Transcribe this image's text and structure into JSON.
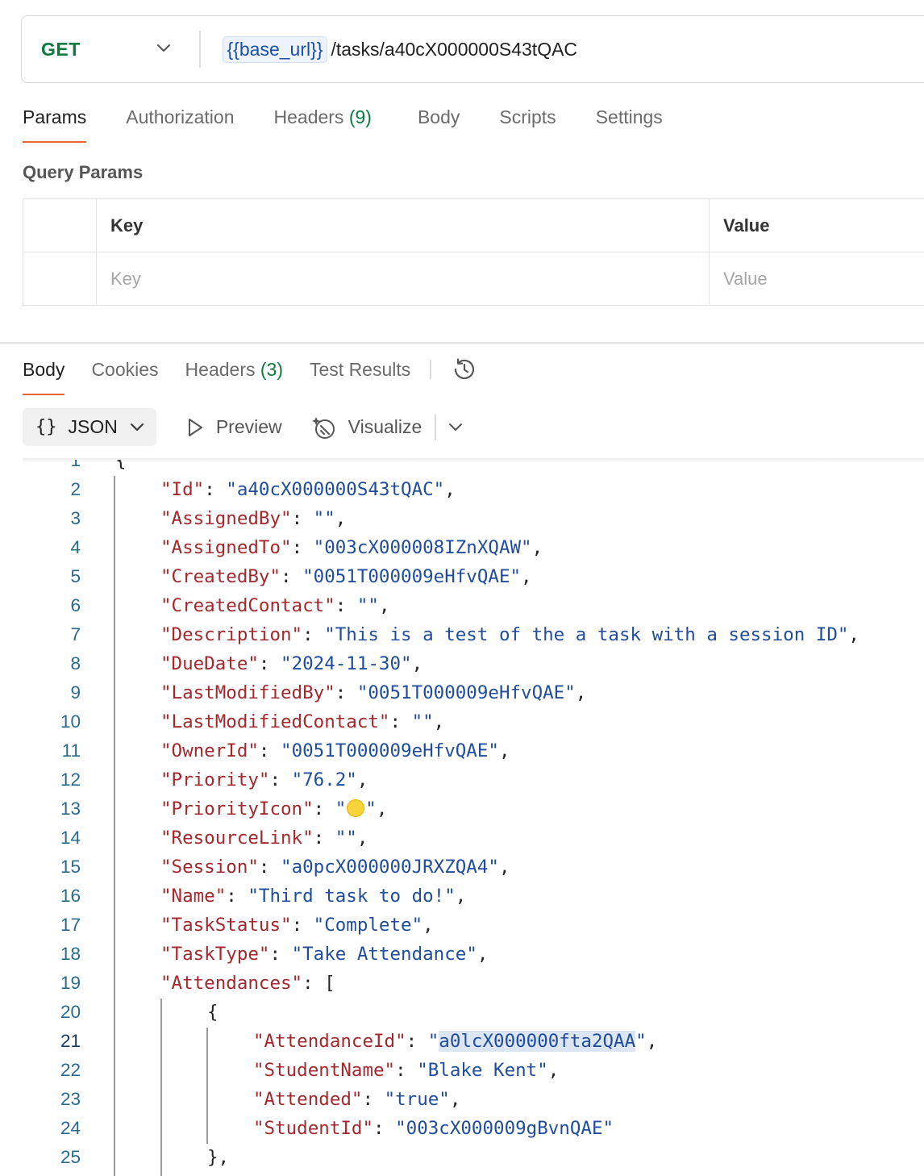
{
  "request": {
    "method": "GET",
    "url_variable": "{{base_url}}",
    "url_path": "/tasks/a40cX000000S43tQAC"
  },
  "request_tabs": [
    {
      "label": "Params",
      "count": ""
    },
    {
      "label": "Authorization",
      "count": ""
    },
    {
      "label": "Headers",
      "count": "(9)"
    },
    {
      "label": "Body",
      "count": ""
    },
    {
      "label": "Scripts",
      "count": ""
    },
    {
      "label": "Settings",
      "count": ""
    }
  ],
  "query_params": {
    "title": "Query Params",
    "col_key": "Key",
    "col_value": "Value",
    "key_placeholder": "Key",
    "value_placeholder": "Value"
  },
  "response_tabs": [
    {
      "label": "Body",
      "count": ""
    },
    {
      "label": "Cookies",
      "count": ""
    },
    {
      "label": "Headers",
      "count": "(3)"
    },
    {
      "label": "Test Results",
      "count": ""
    }
  ],
  "toolbar": {
    "format": "JSON",
    "preview": "Preview",
    "visualize": "Visualize"
  },
  "colors": {
    "method": "#0c7a3e",
    "active_tab": "#e8643a",
    "json_key": "#a3282d",
    "json_string": "#1f4c9c"
  },
  "code_lines": [
    {
      "n": "1",
      "indent": 0,
      "text": "{"
    },
    {
      "n": "2",
      "indent": 1,
      "key": "Id",
      "value": "a40cX000000S43tQAC",
      "comma": true
    },
    {
      "n": "3",
      "indent": 1,
      "key": "AssignedBy",
      "value": "",
      "comma": true
    },
    {
      "n": "4",
      "indent": 1,
      "key": "AssignedTo",
      "value": "003cX000008IZnXQAW",
      "comma": true
    },
    {
      "n": "5",
      "indent": 1,
      "key": "CreatedBy",
      "value": "0051T000009eHfvQAE",
      "comma": true
    },
    {
      "n": "6",
      "indent": 1,
      "key": "CreatedContact",
      "value": "",
      "comma": true
    },
    {
      "n": "7",
      "indent": 1,
      "key": "Description",
      "value": "This is a test of the a task with a session ID",
      "comma": true
    },
    {
      "n": "8",
      "indent": 1,
      "key": "DueDate",
      "value": "2024-11-30",
      "comma": true
    },
    {
      "n": "9",
      "indent": 1,
      "key": "LastModifiedBy",
      "value": "0051T000009eHfvQAE",
      "comma": true
    },
    {
      "n": "10",
      "indent": 1,
      "key": "LastModifiedContact",
      "value": "",
      "comma": true
    },
    {
      "n": "11",
      "indent": 1,
      "key": "OwnerId",
      "value": "0051T000009eHfvQAE",
      "comma": true
    },
    {
      "n": "12",
      "indent": 1,
      "key": "Priority",
      "value": "76.2",
      "comma": true
    },
    {
      "n": "13",
      "indent": 1,
      "key": "PriorityIcon",
      "value": "",
      "emoji": "yellow-circle-icon",
      "comma": true
    },
    {
      "n": "14",
      "indent": 1,
      "key": "ResourceLink",
      "value": "",
      "comma": true
    },
    {
      "n": "15",
      "indent": 1,
      "key": "Session",
      "value": "a0pcX000000JRXZQA4",
      "comma": true
    },
    {
      "n": "16",
      "indent": 1,
      "key": "Name",
      "value": "Third task to do!",
      "comma": true
    },
    {
      "n": "17",
      "indent": 1,
      "key": "TaskStatus",
      "value": "Complete",
      "comma": true
    },
    {
      "n": "18",
      "indent": 1,
      "key": "TaskType",
      "value": "Take Attendance",
      "comma": true
    },
    {
      "n": "19",
      "indent": 1,
      "key": "Attendances",
      "raw": "[",
      "comma": false
    },
    {
      "n": "20",
      "indent": 2,
      "text": "{"
    },
    {
      "n": "21",
      "indent": 3,
      "key": "AttendanceId",
      "value": "a0lcX000000fta2QAA",
      "comma": true,
      "highlight": true,
      "current": true
    },
    {
      "n": "22",
      "indent": 3,
      "key": "StudentName",
      "value": "Blake Kent",
      "comma": true
    },
    {
      "n": "23",
      "indent": 3,
      "key": "Attended",
      "value": "true",
      "comma": true
    },
    {
      "n": "24",
      "indent": 3,
      "key": "StudentId",
      "value": "003cX000009gBvnQAE",
      "comma": false
    },
    {
      "n": "25",
      "indent": 2,
      "text": "},"
    }
  ]
}
